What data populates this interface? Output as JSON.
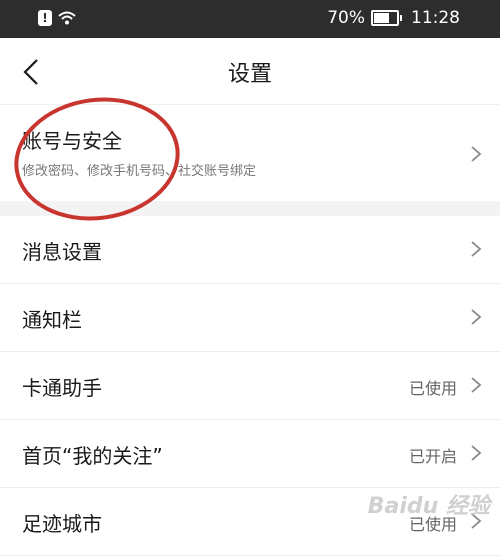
{
  "status_bar": {
    "battery_percent": "70%",
    "battery_level": 0.7,
    "time": "11:28",
    "alert_symbol": "!"
  },
  "header": {
    "title": "设置",
    "back_icon": "chevron-left-icon"
  },
  "account_section": {
    "title": "账号与安全",
    "subtitle": "修改密码、修改手机号码、社交账号绑定"
  },
  "list": {
    "items": [
      {
        "label": "消息设置",
        "value": ""
      },
      {
        "label": "通知栏",
        "value": ""
      },
      {
        "label": "卡通助手",
        "value": "已使用"
      },
      {
        "label": "首页“我的关注”",
        "value": "已开启"
      },
      {
        "label": "足迹城市",
        "value": "已使用"
      }
    ]
  },
  "watermark": {
    "text": "Baidu 经验"
  },
  "colors": {
    "statusbar": "#2d2d2d",
    "annotation": "#c8342e",
    "separator": "#f3f3f3"
  }
}
